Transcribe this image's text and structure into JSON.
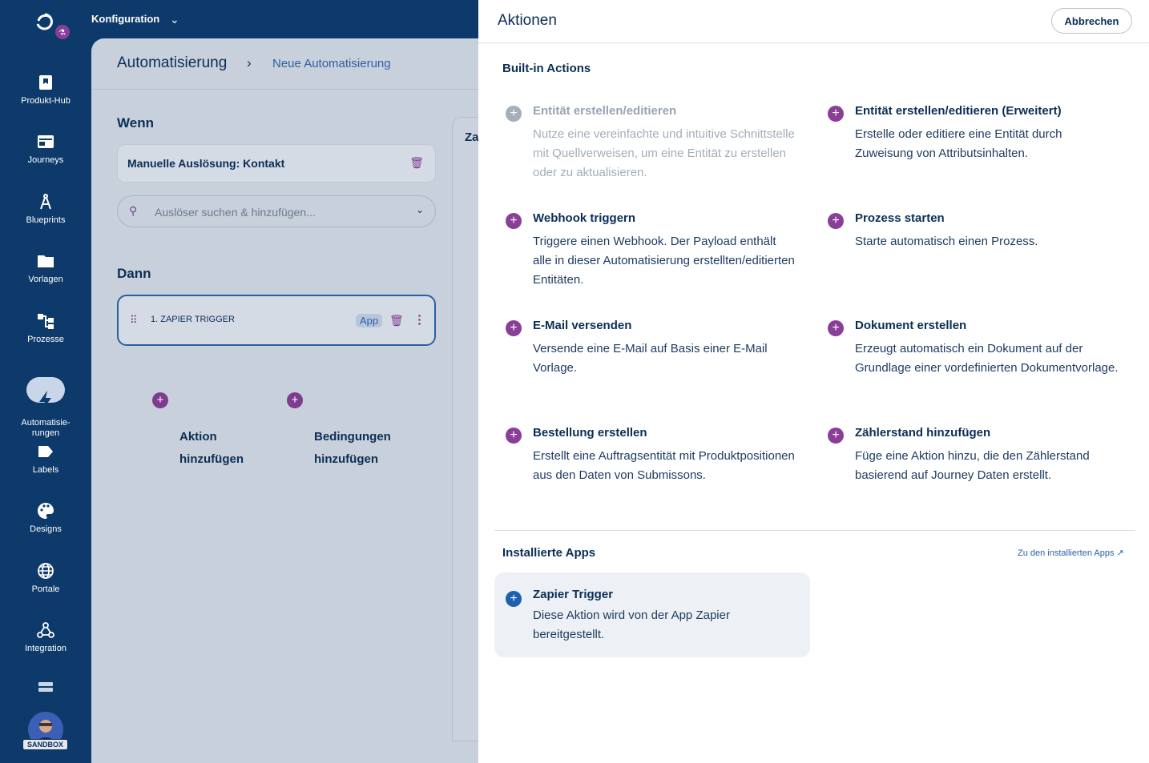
{
  "topbar": {
    "section": "Konfiguration"
  },
  "sidebar": {
    "items": [
      {
        "label": "Produkt-Hub",
        "icon": "bookmark-icon"
      },
      {
        "label": "Journeys",
        "icon": "journey-icon"
      },
      {
        "label": "Blueprints",
        "icon": "compass-icon"
      },
      {
        "label": "Vorlagen",
        "icon": "folder-icon"
      },
      {
        "label": "Prozesse",
        "icon": "process-icon"
      },
      {
        "label": "Automatisie-\nrungen",
        "icon": "lightning-icon",
        "active": true
      },
      {
        "label": "Labels",
        "icon": "label-icon"
      },
      {
        "label": "Designs",
        "icon": "palette-icon"
      },
      {
        "label": "Portale",
        "icon": "globe-icon"
      },
      {
        "label": "Integration",
        "icon": "webhook-icon"
      }
    ],
    "badge": "SANDBOX"
  },
  "main": {
    "breadcrumb": {
      "root": "Automatisierung",
      "current": "Neue Automatisierung"
    },
    "when_title": "Wenn",
    "trigger_card": "Manuelle Auslösung: Kontakt",
    "search_placeholder": "Auslöser suchen & hinzufügen...",
    "then_title": "Dann",
    "action_card": {
      "label": "1. ZAPIER TRIGGER",
      "badge": "App"
    },
    "add_action": "Aktion\nhinzufügen",
    "add_conditions": "Bedingungen\nhinzufügen",
    "side_panel_title": "Za"
  },
  "drawer": {
    "title": "Aktionen",
    "cancel": "Abbrechen",
    "builtin_title": "Built-in Actions",
    "builtin_actions": [
      {
        "name": "Entität erstellen/editieren",
        "desc": "Nutze eine vereinfachte und intuitive Schnittstelle mit Quellverweisen, um eine Entität zu erstellen oder zu aktualisieren.",
        "disabled": true
      },
      {
        "name": "Entität erstellen/editieren (Erweitert)",
        "desc": "Erstelle oder editiere eine Entität durch Zuweisung von Attributsinhalten."
      },
      {
        "name": "Webhook triggern",
        "desc": "Triggere einen Webhook. Der Payload enthält alle in dieser Automatisierung erstellten/editierten Entitäten."
      },
      {
        "name": "Prozess starten",
        "desc": "Starte automatisch einen Prozess."
      },
      {
        "name": "E-Mail versenden",
        "desc": "Versende eine E-Mail auf Basis einer E-Mail Vorlage."
      },
      {
        "name": "Dokument erstellen",
        "desc": "Erzeugt automatisch ein Dokument auf der Grundlage einer vordefinierten Dokumentvorlage."
      },
      {
        "name": "Bestellung erstellen",
        "desc": "Erstellt eine Auftragsentität mit Produktpositionen aus den Daten von Submissons."
      },
      {
        "name": "Zählerstand hinzufügen",
        "desc": "Füge eine Aktion hinzu, die den Zählerstand basierend auf Journey Daten erstellt."
      }
    ],
    "installed_title": "Installierte Apps",
    "installed_link": "Zu den installierten Apps",
    "installed_apps": [
      {
        "name": "Zapier Trigger",
        "desc": "Diese Aktion wird von der App Zapier bereitgestellt."
      }
    ]
  },
  "colors": {
    "sidebar_bg": "#0d3a6b",
    "accent_purple": "#8a3e98",
    "accent_blue": "#1f5fb0"
  }
}
